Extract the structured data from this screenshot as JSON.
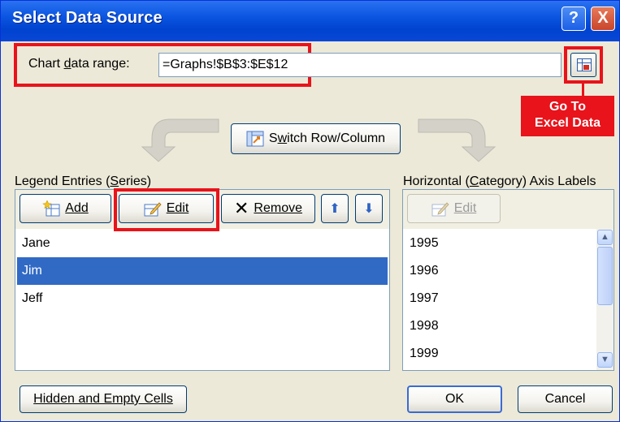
{
  "window": {
    "title": "Select Data Source",
    "help_label": "?",
    "close_label": "X"
  },
  "range": {
    "label_pre": "Chart ",
    "label_key": "d",
    "label_post": "ata range:",
    "value": "=Graphs!$B$3:$E$12"
  },
  "callout": {
    "line1": "Go To",
    "line2": "Excel Data"
  },
  "switch": {
    "label_pre": "S",
    "label_key": "w",
    "label_post": "itch Row/Column"
  },
  "legend": {
    "label_pre": "Legend Entries (",
    "label_key": "S",
    "label_post": "eries)",
    "add_label": "Add",
    "edit_label": "Edit",
    "remove_label": "Remove",
    "items": [
      "Jane",
      "Jim",
      "Jeff"
    ],
    "selected_index": 1
  },
  "axis": {
    "label_pre": "Horizontal (",
    "label_key": "C",
    "label_post": "ategory) Axis Labels",
    "edit_label": "Edit",
    "items": [
      "1995",
      "1996",
      "1997",
      "1998",
      "1999"
    ]
  },
  "footer": {
    "hidden_label": "Hidden and Empty Cells",
    "ok_label": "OK",
    "cancel_label": "Cancel"
  }
}
